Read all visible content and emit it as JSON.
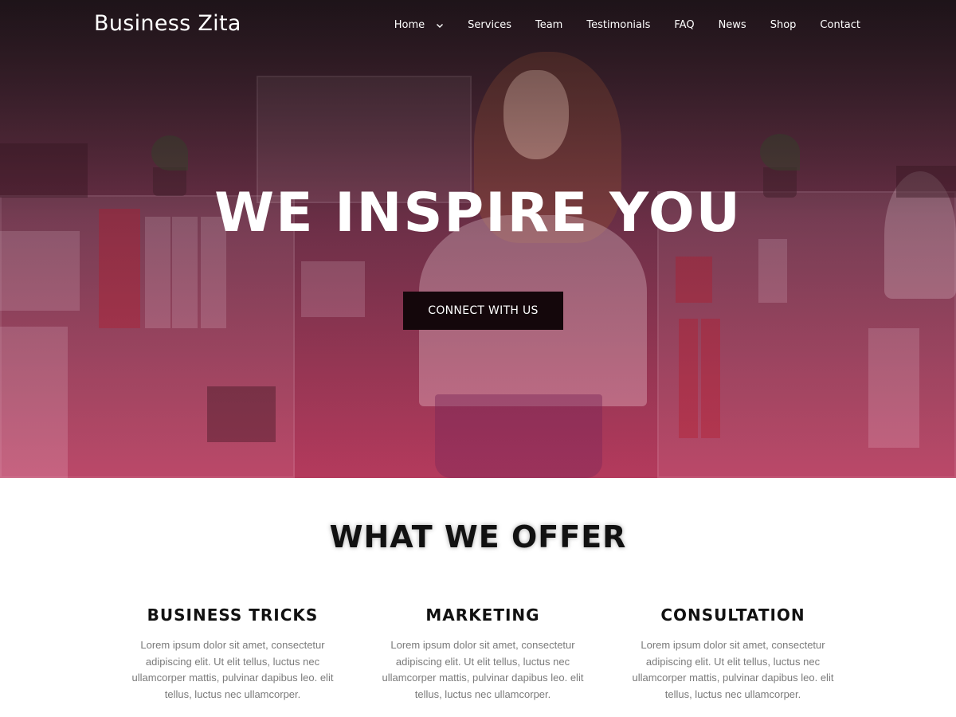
{
  "header": {
    "brand": "Business Zita",
    "nav": [
      {
        "label": "Home",
        "has_dropdown": true
      },
      {
        "label": "Services"
      },
      {
        "label": "Team"
      },
      {
        "label": "Testimonials"
      },
      {
        "label": "FAQ"
      },
      {
        "label": "News"
      },
      {
        "label": "Shop"
      },
      {
        "label": "Contact"
      }
    ]
  },
  "hero": {
    "title": "WE INSPIRE YOU",
    "cta_label": "CONNECT WITH US"
  },
  "offer": {
    "title": "WHAT WE OFFER",
    "items": [
      {
        "title": "BUSINESS TRICKS",
        "text": "Lorem ipsum dolor sit amet, consectetur adipiscing elit. Ut elit tellus, luctus nec ullamcorper mattis, pulvinar dapibus leo. elit tellus, luctus nec ullamcorper."
      },
      {
        "title": "MARKETING",
        "text": "Lorem ipsum dolor sit amet, consectetur adipiscing elit. Ut elit tellus, luctus nec ullamcorper mattis, pulvinar dapibus leo. elit tellus, luctus nec ullamcorper."
      },
      {
        "title": "CONSULTATION",
        "text": "Lorem ipsum dolor sit amet, consectetur adipiscing elit. Ut elit tellus, luctus nec ullamcorper mattis, pulvinar dapibus leo. elit tellus, luctus nec ullamcorper."
      }
    ]
  },
  "colors": {
    "hero_overlay_top": "#2a1b22",
    "hero_overlay_bottom": "#b23c5e",
    "cta_background": "#14070b",
    "heading_text": "#111111",
    "body_text": "#7a7a7a"
  },
  "icons": {
    "home_dropdown": "chevron-down-icon"
  }
}
